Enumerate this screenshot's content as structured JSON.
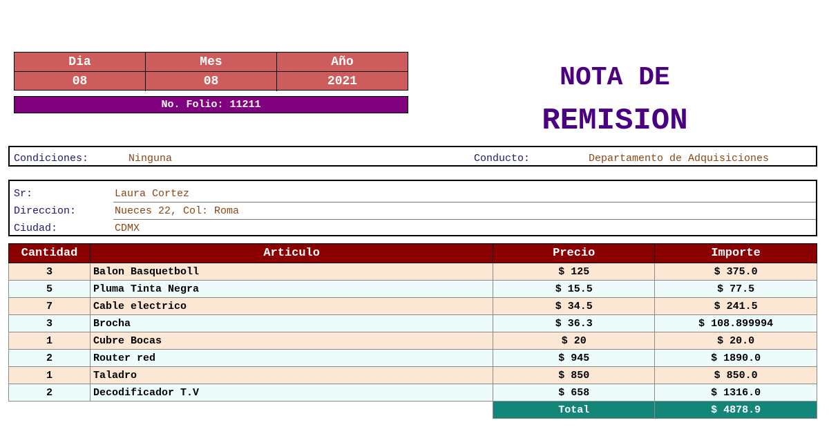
{
  "date": {
    "headers": [
      "Dia",
      "Mes",
      "Año"
    ],
    "values": [
      "08",
      "08",
      "2021"
    ]
  },
  "folio": "No. Folio: 11211",
  "title": {
    "line1": "NOTA DE",
    "line2": "REMISION"
  },
  "conditions": {
    "label": "Condiciones:",
    "value": "Ninguna",
    "conduct_label": "Conducto:",
    "conduct_value": "Departamento de Adquisiciones"
  },
  "customer": {
    "sr_label": "Sr:",
    "sr_value": "Laura Cortez",
    "dir_label": "Direccion:",
    "dir_value": "Nueces 22, Col: Roma",
    "city_label": "Ciudad:",
    "city_value": "CDMX"
  },
  "table": {
    "headers": [
      "Cantidad",
      "Articulo",
      "Precio",
      "Importe"
    ],
    "rows": [
      {
        "qty": "3",
        "item": "Balon Basquetboll",
        "price": "$ 125",
        "amount": "$ 375.0"
      },
      {
        "qty": "5",
        "item": "Pluma Tinta Negra",
        "price": "$ 15.5",
        "amount": "$ 77.5"
      },
      {
        "qty": "7",
        "item": "Cable electrico",
        "price": "$ 34.5",
        "amount": "$ 241.5"
      },
      {
        "qty": "3",
        "item": "Brocha",
        "price": "$ 36.3",
        "amount": "$ 108.899994"
      },
      {
        "qty": "1",
        "item": "Cubre Bocas",
        "price": "$ 20",
        "amount": "$ 20.0"
      },
      {
        "qty": "2",
        "item": "Router red",
        "price": "$ 945",
        "amount": "$ 1890.0"
      },
      {
        "qty": "1",
        "item": "Taladro",
        "price": "$ 850",
        "amount": "$ 850.0"
      },
      {
        "qty": "2",
        "item": "Decodificador T.V",
        "price": "$ 658",
        "amount": "$ 1316.0"
      }
    ],
    "total_label": "Total",
    "total_value": "$ 4878.9"
  },
  "colors": {
    "date_bg": "#cd5c5c",
    "folio_bg": "#800080",
    "title": "#4b0082",
    "header_bg": "#8b0000",
    "total_bg": "#138579"
  }
}
